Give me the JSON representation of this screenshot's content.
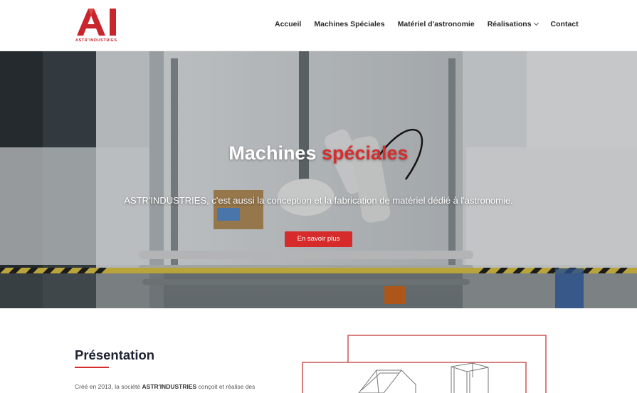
{
  "header": {
    "logo_letters": "AI",
    "logo_subtext": "ASTR'INDUSTRIES",
    "nav": [
      {
        "label": "Accueil"
      },
      {
        "label": "Machines Spéciales"
      },
      {
        "label": "Matériel d'astronomie"
      },
      {
        "label": "Réalisations"
      },
      {
        "label": "Contact"
      }
    ]
  },
  "hero": {
    "title_part1": "Machines",
    "title_part2": "spéciales",
    "subtitle": "ASTR'INDUSTRIES, c'est aussi la conception et la fabrication de matériel dédié à l'astronomie.",
    "button_label": "En savoir plus"
  },
  "presentation": {
    "title": "Présentation",
    "text_prefix": "Créé en 2013, la société",
    "text_strong": "ASTR'INDUSTRIES",
    "text_suffix": "conçoit et réalise des"
  },
  "colors": {
    "accent": "#d72a2a",
    "heading": "#1e2330",
    "text": "#555555"
  }
}
